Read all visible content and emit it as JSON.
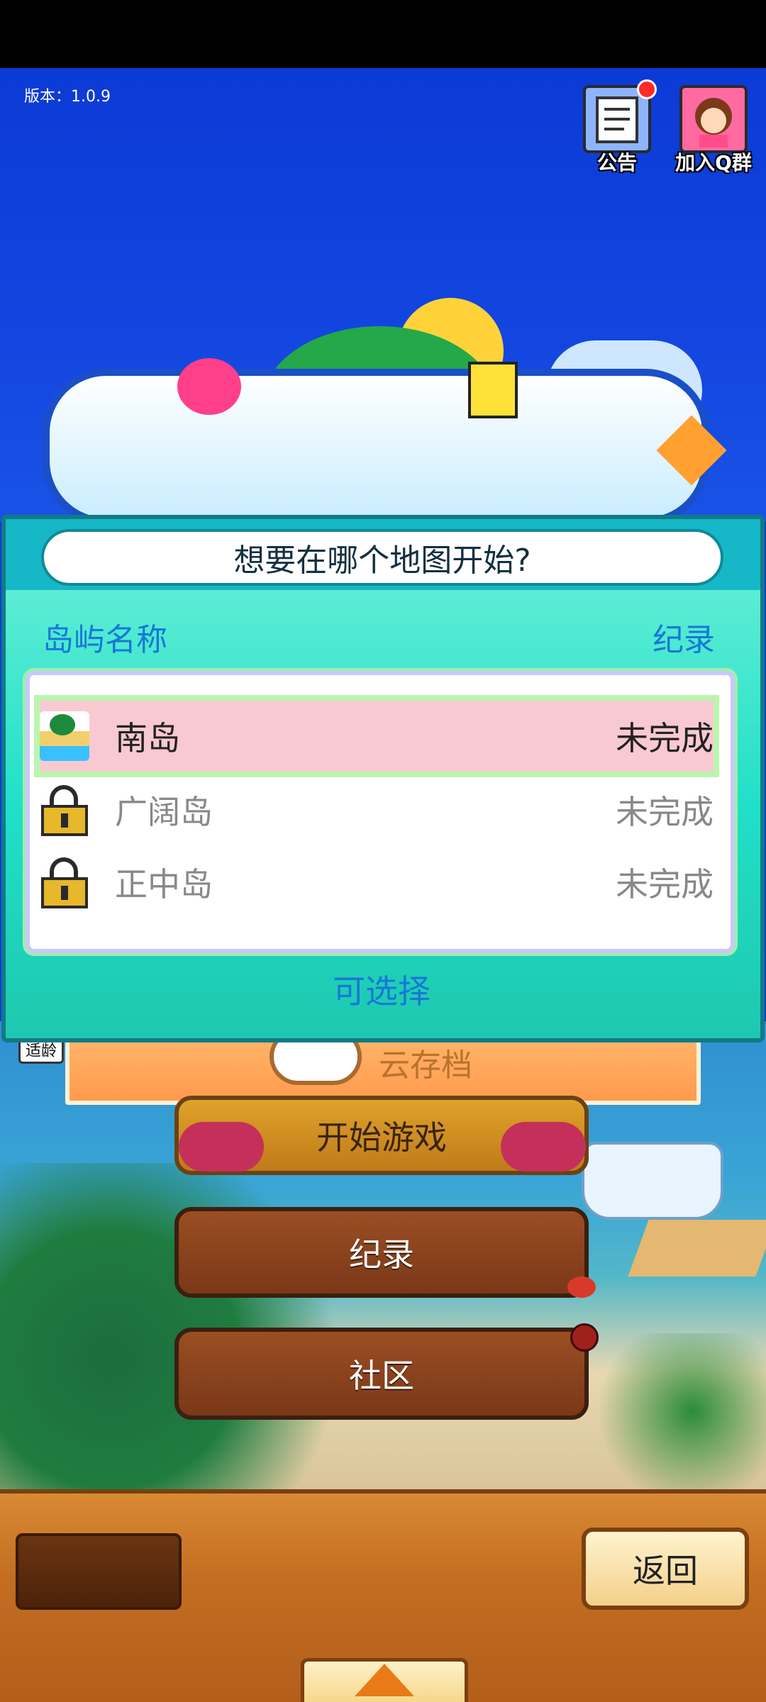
{
  "version_text": "版本：1.0.9",
  "top_buttons": {
    "notice_label": "公告",
    "qq_group_label": "加入Q群"
  },
  "dialog": {
    "title": "想要在哪个地图开始?",
    "column_name": "岛屿名称",
    "column_record": "纪录",
    "islands": [
      {
        "name": "南岛",
        "status": "未完成",
        "locked": false,
        "selected": true
      },
      {
        "name": "广阔岛",
        "status": "未完成",
        "locked": true,
        "selected": false
      },
      {
        "name": "正中岛",
        "status": "未完成",
        "locked": true,
        "selected": false
      }
    ],
    "footer_hint": "可选择"
  },
  "menu": {
    "age_badge": "适龄",
    "cloud_save": "云存档",
    "start_game": "开始游戏",
    "records": "纪录",
    "community": "社区"
  },
  "bottom": {
    "back_label": "返回"
  },
  "colors": {
    "dialog_accent": "#1778d6",
    "selected_row": "#f9c9d2",
    "dialog_bg": "#21e0c8"
  },
  "icons": {
    "island": "island-icon",
    "locked": "lock-icon",
    "notice": "notice-icon",
    "qq_group": "character-avatar-icon",
    "expand": "triangle-up-icon"
  }
}
